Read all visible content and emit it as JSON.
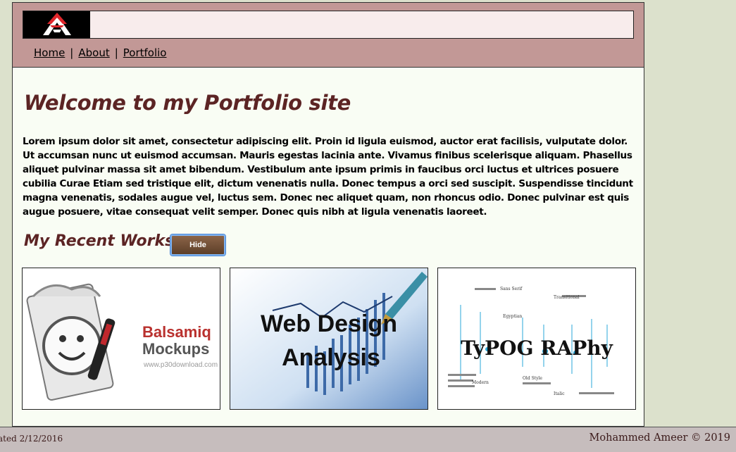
{
  "nav": {
    "home": "Home",
    "about": "About",
    "portfolio": "Portfolio",
    "separator": "|"
  },
  "main": {
    "title": "Welcome to my Portfolio site",
    "intro": "Lorem ipsum dolor sit amet, consectetur adipiscing elit. Proin id ligula euismod, auctor erat facilisis, vulputate dolor. Ut accumsan nunc ut euismod accumsan. Mauris egestas lacinia ante. Vivamus finibus scelerisque aliquam. Phasellus aliquet pulvinar massa sit amet bibendum. Vestibulum ante ipsum primis in faucibus orci luctus et ultrices posuere cubilia Curae Etiam sed tristique elit, dictum venenatis nulla. Donec tempus a orci sed suscipit. Suspendisse tincidunt magna venenatis, sodales augue vel, luctus sem. Donec nec aliquet quam, non rhoncus odio. Donec pulvinar est quis augue posuere, vitae consequat velit semper. Donec quis nibh at ligula venenatis laoreet.",
    "works_title": "My Recent Works",
    "hide_button": "Hide"
  },
  "works": [
    {
      "icon": "balsamiq-logo-icon",
      "line1": "Balsamiq",
      "line2": "Mockups",
      "line3": "www.p30download.com"
    },
    {
      "icon": "chart-pen-icon",
      "line1": "Web Design",
      "line2": "Analysis"
    },
    {
      "icon": "typography-icon",
      "word": "TyPOG RAPhy",
      "labels": [
        "Sans Serif",
        "Transitional",
        "Egyptian",
        "Old Style",
        "Modern",
        "Italic"
      ]
    }
  ],
  "footer": {
    "updated": "ated 2/12/2016",
    "copyright": "Mohammed Ameer © 2019"
  },
  "colors": {
    "header": "#c29896",
    "heading": "#5c2424",
    "page_bg": "#dce1cc",
    "footer_bg": "#c6bdbd"
  }
}
